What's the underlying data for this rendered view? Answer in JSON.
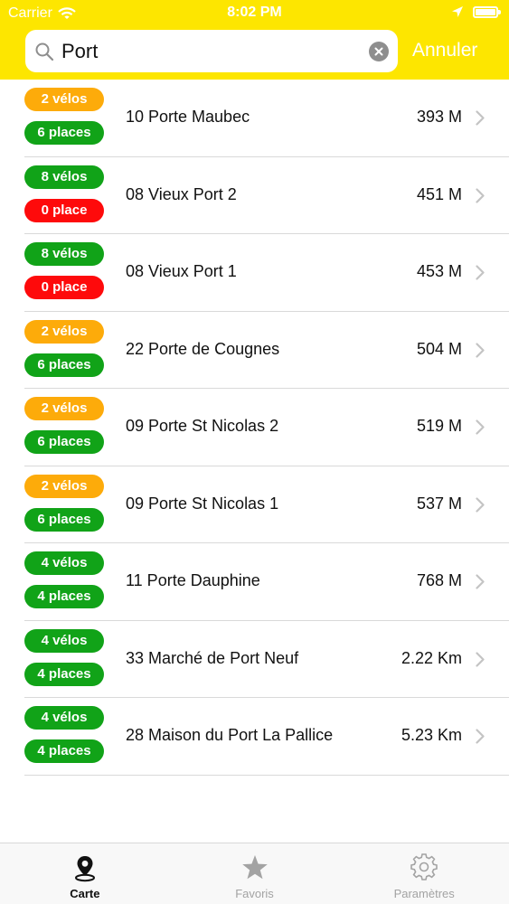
{
  "status_bar": {
    "carrier": "Carrier",
    "time": "8:02 PM"
  },
  "search": {
    "value": "Port",
    "cancel_label": "Annuler"
  },
  "colors": {
    "header": "#fde600",
    "orange": "#fdab0a",
    "green": "#11a318",
    "red": "#fe0a0b"
  },
  "stations": [
    {
      "bikes": "2 vélos",
      "bikes_level": "orange",
      "places": "6 places",
      "places_level": "green",
      "name": "10 Porte Maubec",
      "distance": "393 M"
    },
    {
      "bikes": "8 vélos",
      "bikes_level": "green",
      "places": "0 place",
      "places_level": "red",
      "name": "08 Vieux Port 2",
      "distance": "451 M"
    },
    {
      "bikes": "8 vélos",
      "bikes_level": "green",
      "places": "0 place",
      "places_level": "red",
      "name": "08 Vieux Port 1",
      "distance": "453 M"
    },
    {
      "bikes": "2 vélos",
      "bikes_level": "orange",
      "places": "6 places",
      "places_level": "green",
      "name": "22 Porte de Cougnes",
      "distance": "504 M"
    },
    {
      "bikes": "2 vélos",
      "bikes_level": "orange",
      "places": "6 places",
      "places_level": "green",
      "name": "09 Porte St Nicolas 2",
      "distance": "519 M"
    },
    {
      "bikes": "2 vélos",
      "bikes_level": "orange",
      "places": "6 places",
      "places_level": "green",
      "name": "09 Porte St Nicolas 1",
      "distance": "537 M"
    },
    {
      "bikes": "4 vélos",
      "bikes_level": "green",
      "places": "4 places",
      "places_level": "green",
      "name": "11 Porte Dauphine",
      "distance": "768 M"
    },
    {
      "bikes": "4 vélos",
      "bikes_level": "green",
      "places": "4 places",
      "places_level": "green",
      "name": "33 Marché de Port Neuf",
      "distance": "2.22 Km"
    },
    {
      "bikes": "4 vélos",
      "bikes_level": "green",
      "places": "4 places",
      "places_level": "green",
      "name": "28 Maison du Port La Pallice",
      "distance": "5.23 Km"
    }
  ],
  "tabs": [
    {
      "label": "Carte",
      "icon": "map-pin-icon",
      "active": true
    },
    {
      "label": "Favoris",
      "icon": "star-icon",
      "active": false
    },
    {
      "label": "Paramètres",
      "icon": "gear-icon",
      "active": false
    }
  ]
}
